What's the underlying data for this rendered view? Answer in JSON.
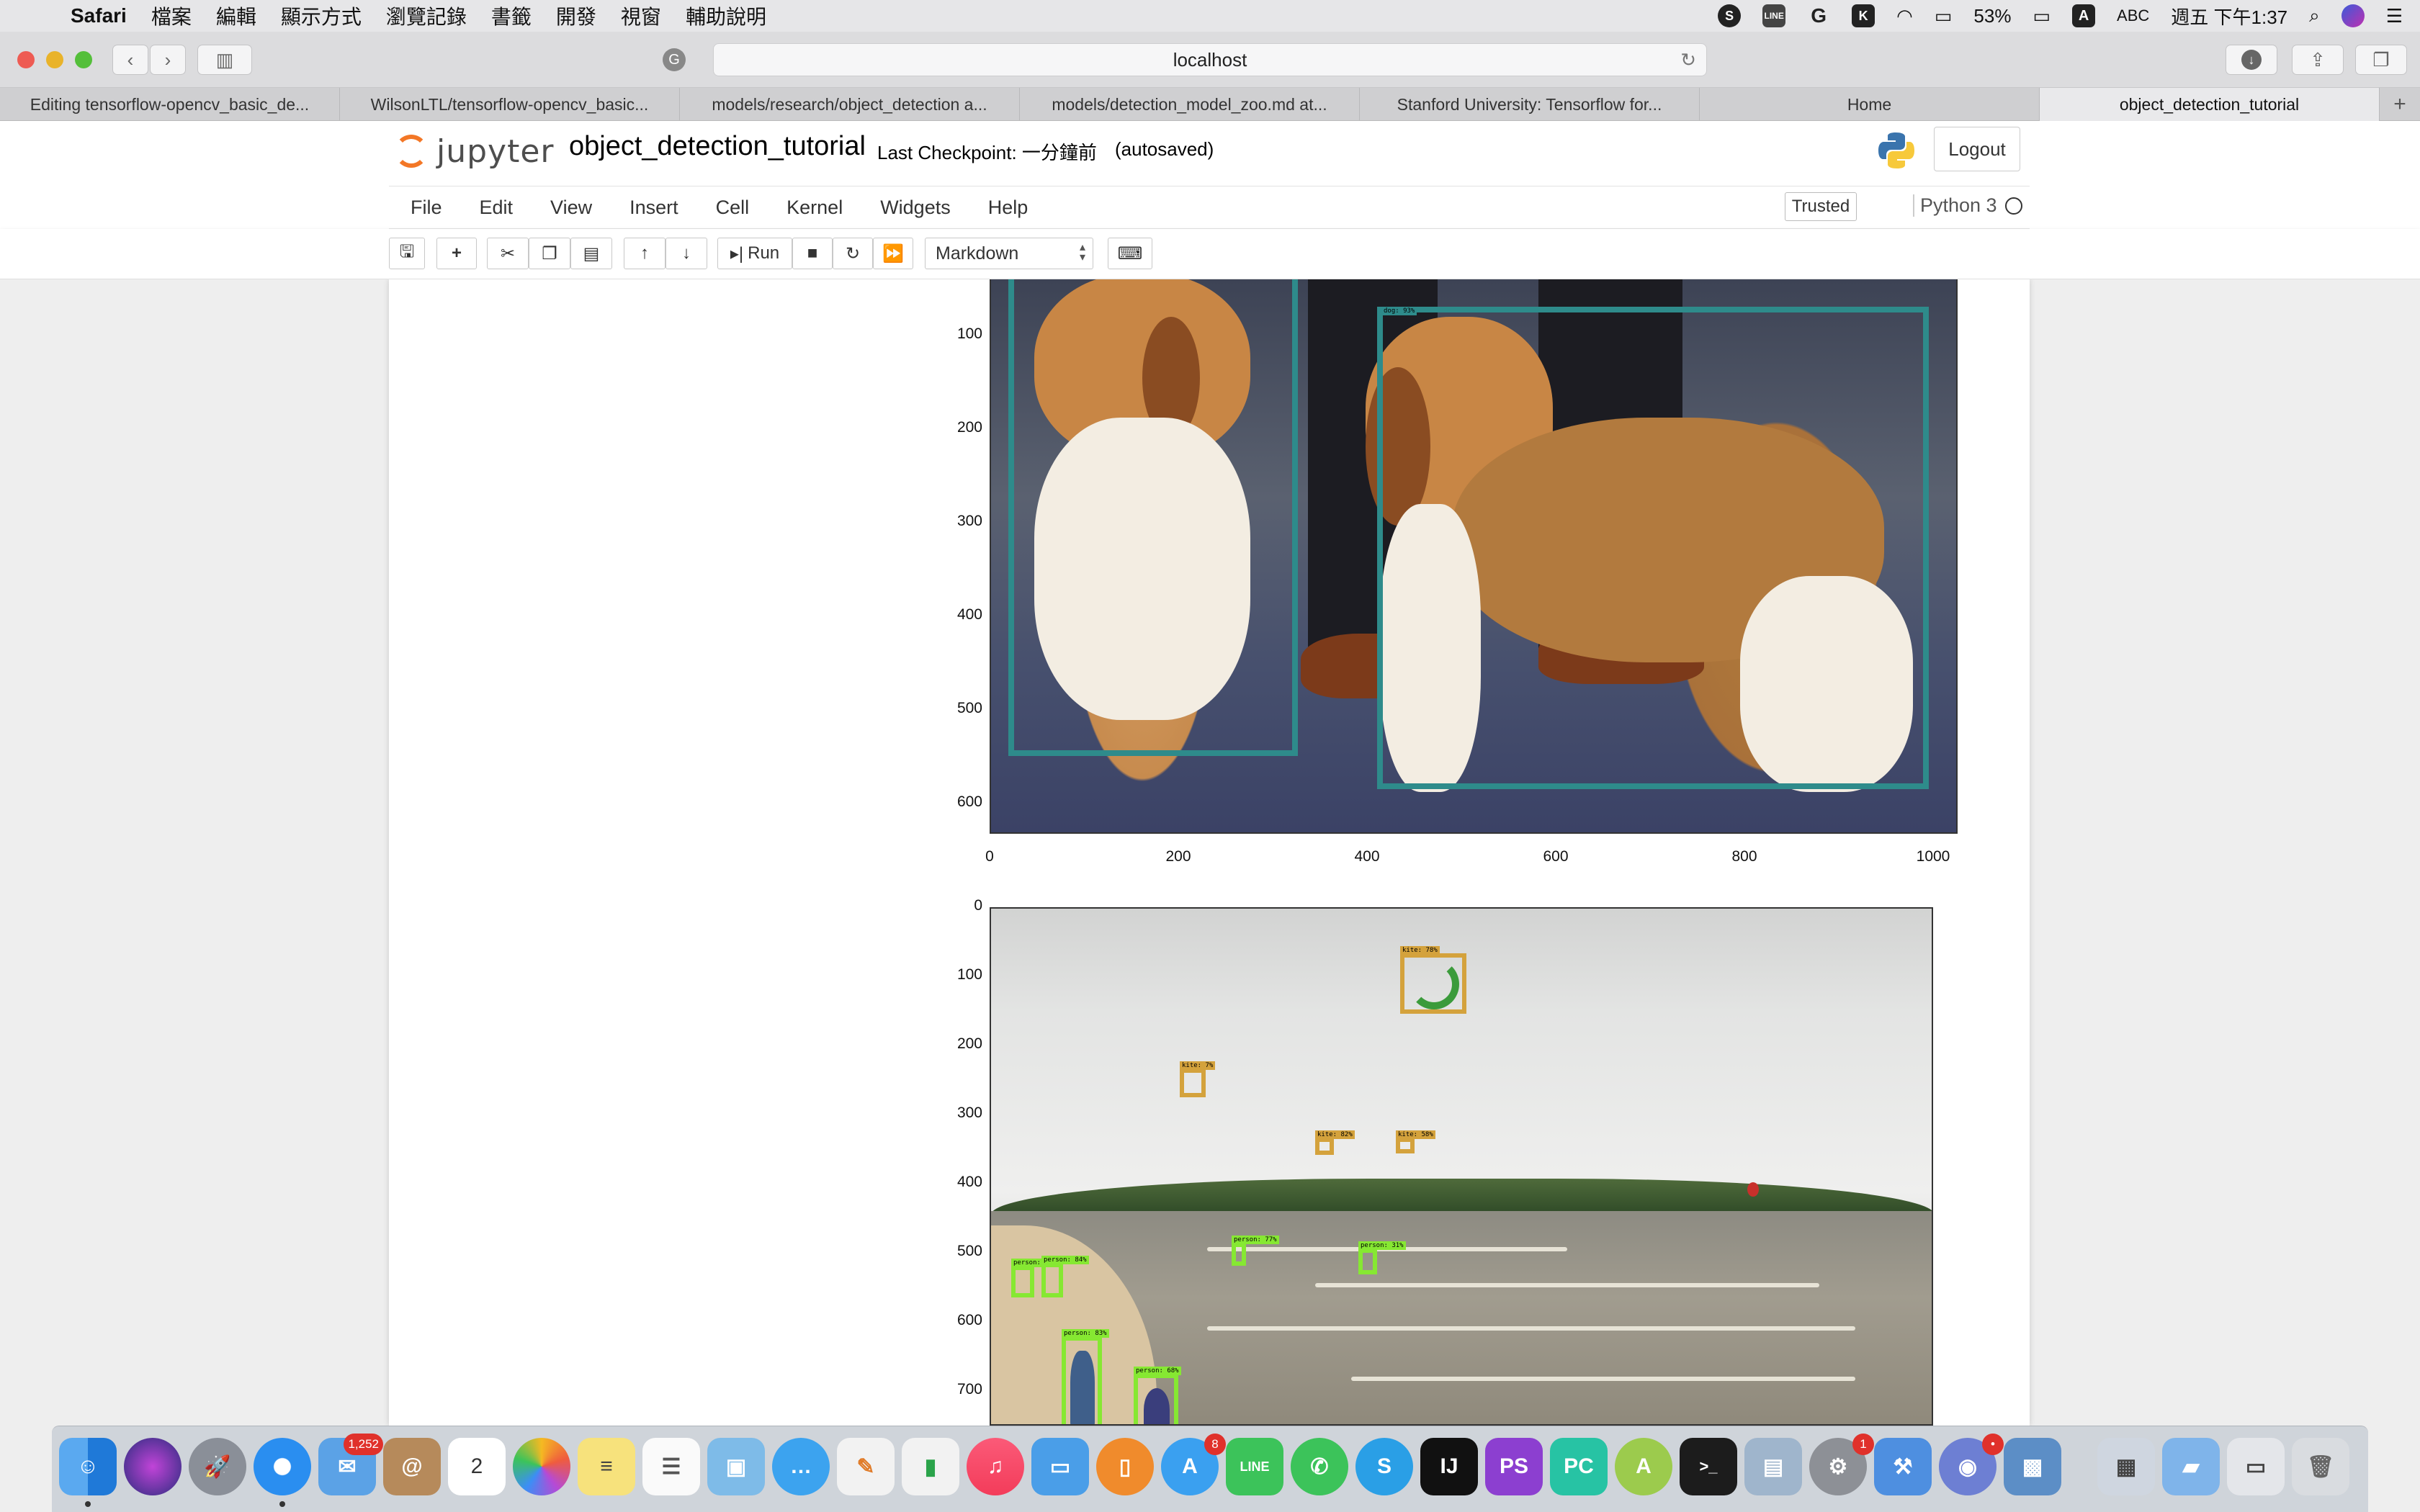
{
  "menubar": {
    "app": "Safari",
    "items": [
      "檔案",
      "編輯",
      "顯示方式",
      "瀏覽記錄",
      "書籤",
      "開發",
      "視窗",
      "輔助說明"
    ],
    "battery": "53%",
    "input_method": "ABC",
    "clock": "週五 下午1:37"
  },
  "browser": {
    "url": "localhost",
    "tabs": [
      {
        "label": "Editing tensorflow-opencv_basic_de..."
      },
      {
        "label": "WilsonLTL/tensorflow-opencv_basic..."
      },
      {
        "label": "models/research/object_detection a..."
      },
      {
        "label": "models/detection_model_zoo.md at..."
      },
      {
        "label": "Stanford University: Tensorflow for..."
      },
      {
        "label": "Home"
      },
      {
        "label": "object_detection_tutorial"
      }
    ],
    "new_tab": "+"
  },
  "jupyter": {
    "logo_text": "jupyter",
    "notebook_name": "object_detection_tutorial",
    "checkpoint": "Last Checkpoint: 一分鐘前",
    "autosave": "(autosaved)",
    "logout": "Logout",
    "menu": [
      "File",
      "Edit",
      "View",
      "Insert",
      "Cell",
      "Kernel",
      "Widgets",
      "Help"
    ],
    "trusted": "Trusted",
    "kernel": "Python 3",
    "toolbar": {
      "run_label": "Run",
      "cell_type": "Markdown"
    }
  },
  "plot1": {
    "yticks": [
      "100",
      "200",
      "300",
      "400",
      "500",
      "600"
    ],
    "xticks": [
      "0",
      "200",
      "400",
      "600",
      "800",
      "1000"
    ],
    "box_labels": [
      "dog: 93%"
    ]
  },
  "plot2": {
    "yticks": [
      "0",
      "100",
      "200",
      "300",
      "400",
      "500",
      "600",
      "700"
    ],
    "box_labels": [
      "kite: 78%",
      "kite: 7%",
      "kite: 82%",
      "kite: 58%",
      "person: 77%",
      "person: 31%",
      "person: 77%",
      "person: 84%",
      "person: 83%",
      "person: 68%"
    ]
  },
  "dock": {
    "badges": {
      "mail": "1,252",
      "calendar_day": "2",
      "appstore": "8",
      "prefs": "1",
      "discord": "•"
    }
  }
}
